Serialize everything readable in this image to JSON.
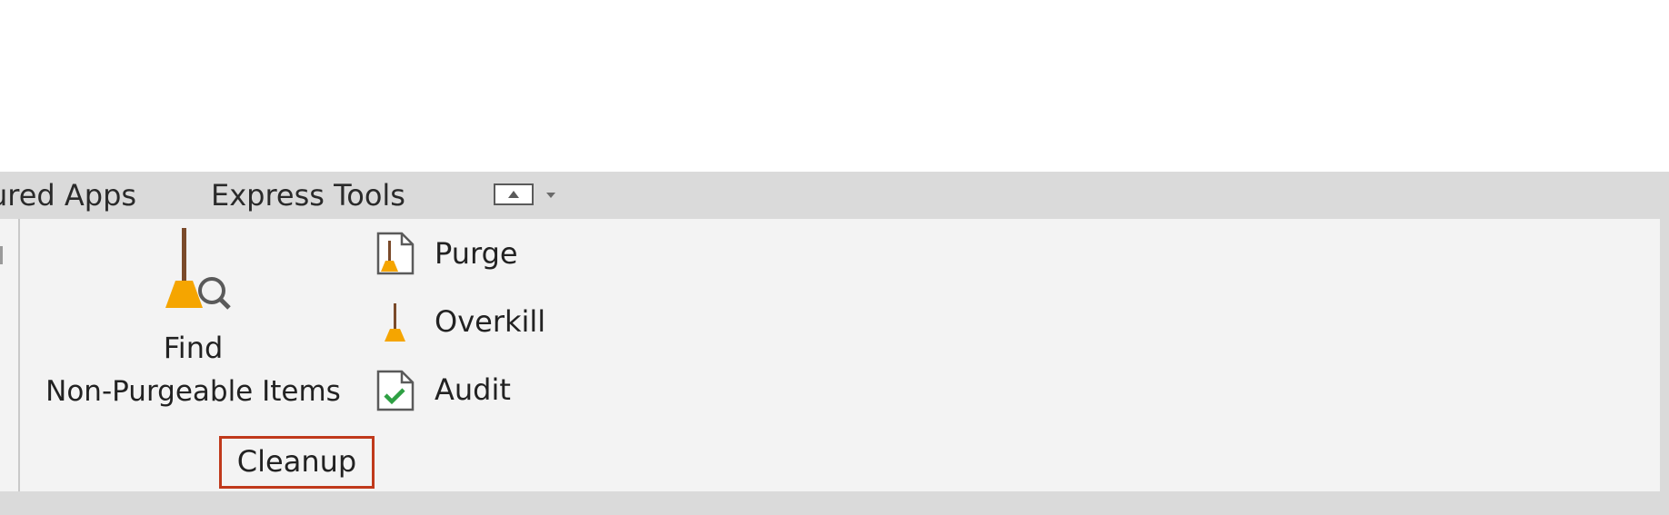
{
  "ribbon": {
    "tabs": [
      {
        "label": "ured Apps"
      },
      {
        "label": "Express Tools"
      }
    ],
    "minimize_control": {
      "icon": "panel-minimize-icon",
      "dropdown_icon": "chevron-down-icon"
    },
    "group": {
      "name": "Cleanup",
      "large_button": {
        "line1": "Find",
        "line2": "Non-Purgeable Items",
        "icon": "broom-magnifier-icon"
      },
      "small_buttons": [
        {
          "label": "Purge",
          "icon": "purge-document-icon"
        },
        {
          "label": "Overkill",
          "icon": "broom-icon"
        },
        {
          "label": "Audit",
          "icon": "audit-check-icon"
        }
      ]
    },
    "colors": {
      "tab_bar": "#dadada",
      "panel": "#f3f3f3",
      "broom": "#f5a500",
      "check": "#2ea043",
      "highlight_border": "#c0391b"
    }
  }
}
